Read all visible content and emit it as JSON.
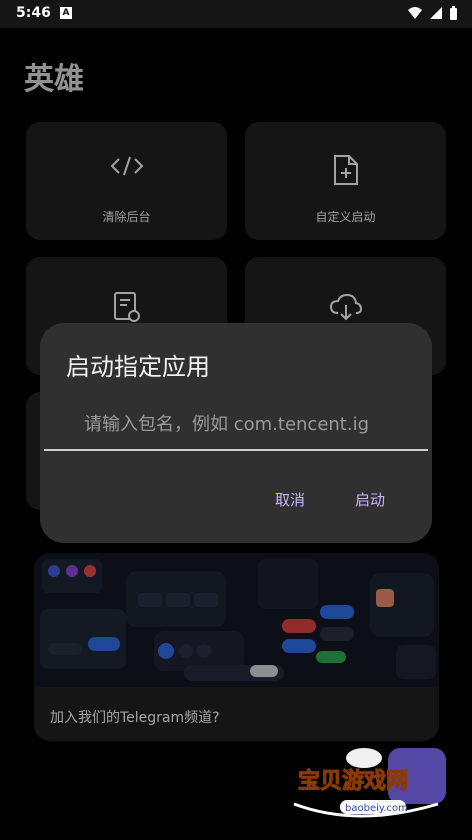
{
  "status_bar": {
    "time": "5:46",
    "badge": "A"
  },
  "app": {
    "title": "英雄"
  },
  "cards": [
    {
      "label": "清除后台",
      "icon": "code-icon"
    },
    {
      "label": "自定义启动",
      "icon": "add-file-icon"
    },
    {
      "label": "",
      "icon": "document-sync-icon"
    },
    {
      "label": "",
      "icon": "cloud-download-icon"
    }
  ],
  "dialog": {
    "title": "启动指定应用",
    "input_placeholder": "请输入包名，例如 com.tencent.ig",
    "cancel": "取消",
    "start": "启动"
  },
  "promo": {
    "text": "加入我们的Telegram频道?"
  },
  "watermark": {
    "brand": "宝贝游戏网",
    "site": "baobeiy.com"
  }
}
